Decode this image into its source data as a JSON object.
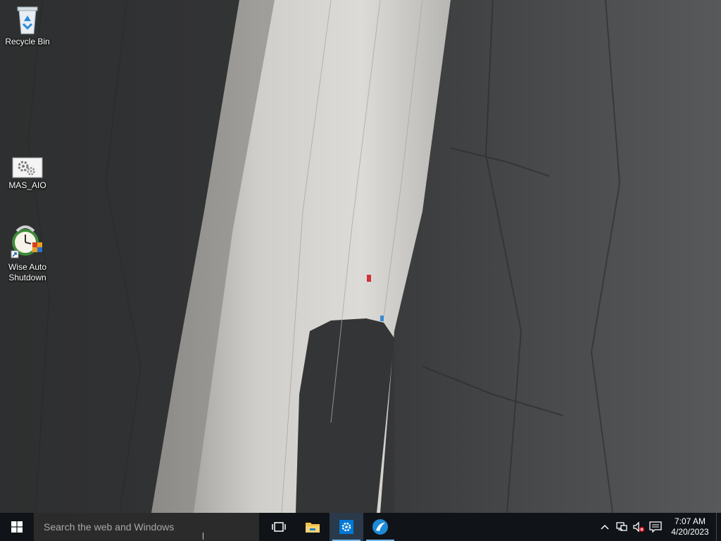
{
  "desktop": {
    "icons": [
      {
        "label": "Recycle Bin",
        "icon": "recycle-bin-icon"
      },
      {
        "label": "MAS_AIO",
        "icon": "gears-script-icon"
      },
      {
        "label": "Wise Auto Shutdown",
        "icon": "alarm-clock-shortcut-icon"
      }
    ]
  },
  "taskbar": {
    "start_icon": "windows-logo-icon",
    "search": {
      "placeholder": "Search the web and Windows",
      "value": ""
    },
    "pinned": [
      {
        "name": "task-view",
        "icon": "task-view-icon"
      },
      {
        "name": "file-explorer",
        "icon": "folder-icon"
      },
      {
        "name": "settings",
        "icon": "gear-icon",
        "state": "active"
      },
      {
        "name": "browser",
        "icon": "browser-swirl-icon",
        "state": "running"
      }
    ],
    "tray": {
      "icons": [
        "chevron-up-icon",
        "network-icon",
        "volume-muted-icon",
        "notification-icon"
      ],
      "time": "7:07 AM",
      "date": "4/20/2023"
    }
  },
  "colors": {
    "taskbar_bg": "#101418",
    "search_bg": "#2b2b2b",
    "accent": "#0078d7",
    "running_indicator": "#76b9ed"
  }
}
